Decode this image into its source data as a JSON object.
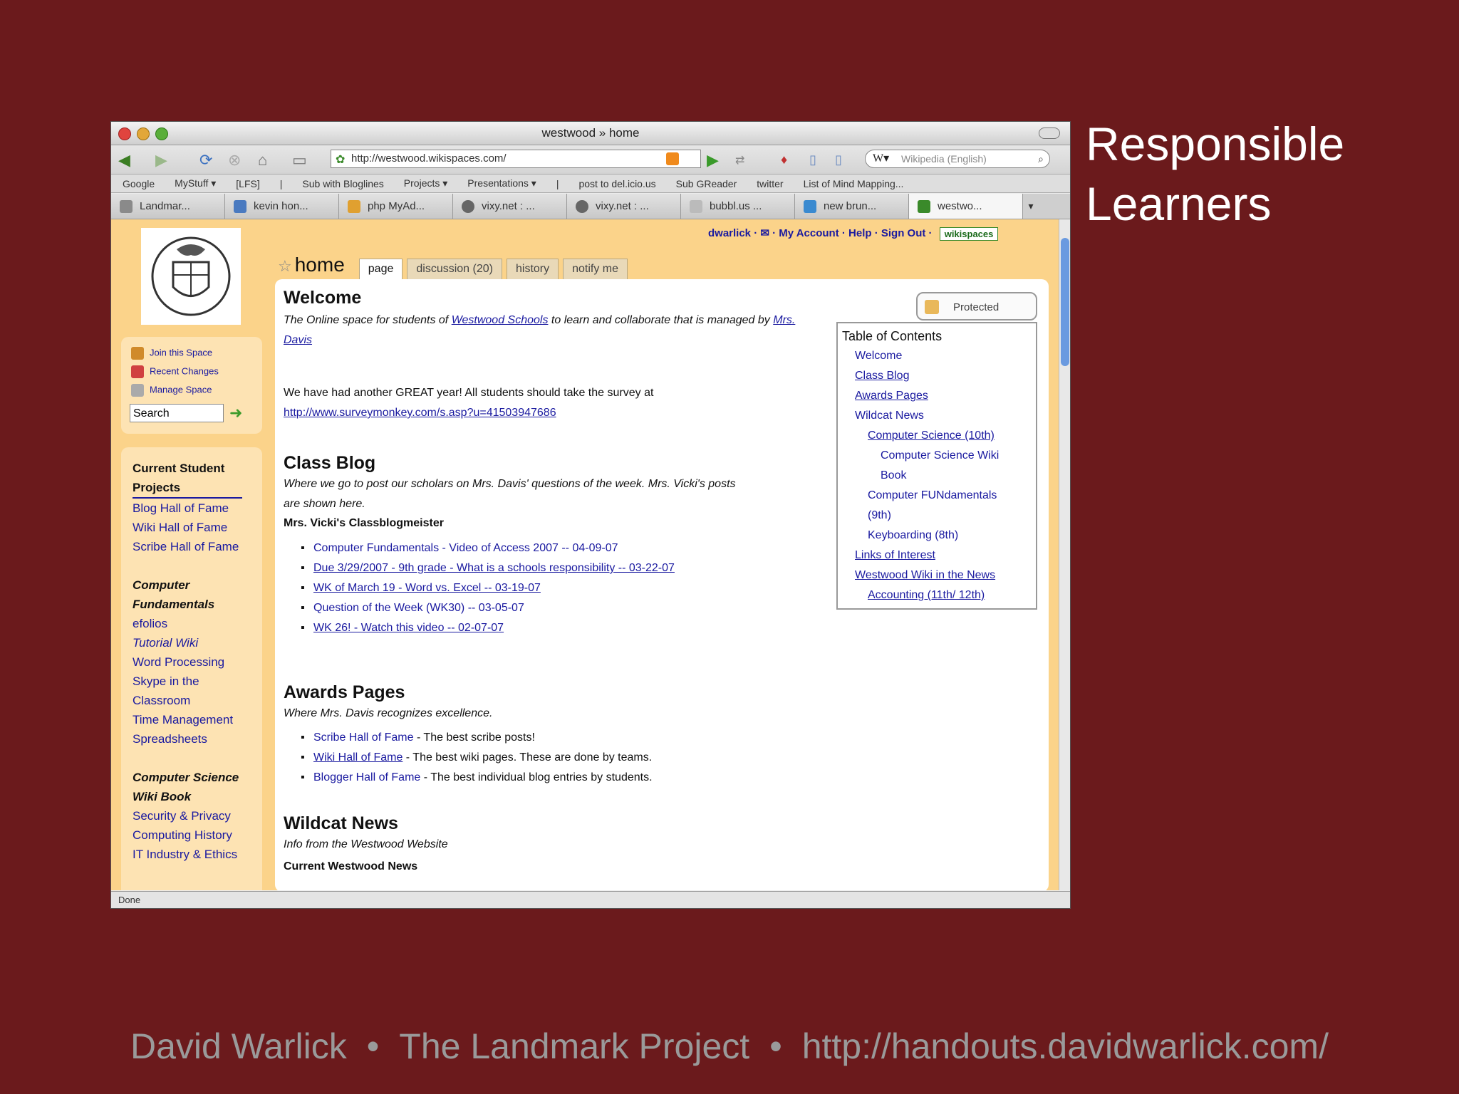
{
  "slide": {
    "title_line1": "Responsible",
    "title_line2": "Learners",
    "footer_author": "David Warlick",
    "footer_sep": "•",
    "footer_project": "The Landmark Project",
    "footer_url": "http://handouts.davidwarlick.com/"
  },
  "browser": {
    "window_title": "westwood » home",
    "url": "http://westwood.wikispaces.com/",
    "search_placeholder": "Wikipedia (English)",
    "status": "Done",
    "bookmarks": [
      "Google",
      "MyStuff ▾",
      "[LFS]",
      "|",
      "Sub with Bloglines",
      "Projects ▾",
      "Presentations ▾",
      "|",
      "post to del.icio.us",
      "Sub GReader",
      "twitter",
      "List of Mind Mapping..."
    ],
    "tabs": [
      "Landmar...",
      "kevin hon...",
      "php MyAd...",
      "vixy.net : ...",
      "vixy.net : ...",
      "bubbl.us ...",
      "new brun...",
      "westwo..."
    ]
  },
  "wiki": {
    "user_links": "dwarlick · ✉ · My Account · Help · Sign Out ·",
    "badge": "wikispaces",
    "home_title": "home",
    "page_tabs": [
      "page",
      "discussion (20)",
      "history",
      "notify me"
    ],
    "side_links": [
      "Join this Space",
      "Recent Changes",
      "Manage Space"
    ],
    "search_value": "Search",
    "projects": {
      "heading1": "Current Student",
      "heading2": "Projects",
      "items1": [
        "Blog Hall of Fame",
        "Wiki Hall of Fame",
        "Scribe Hall of Fame"
      ],
      "cf_heading1": "Computer",
      "cf_heading2": "Fundamentals",
      "cf_items": [
        "efolios",
        "Tutorial Wiki",
        "Word Processing",
        "Skype in the",
        "Classroom",
        "Time Management",
        "Spreadsheets"
      ],
      "cs_heading1": "Computer Science",
      "cs_heading2": "Wiki Book",
      "cs_items": [
        "Security & Privacy",
        "Computing History",
        "IT Industry & Ethics"
      ]
    },
    "protected": "Protected",
    "welcome": {
      "heading": "Welcome",
      "desc_pre": "The Online space for students of ",
      "desc_link": "Westwood Schools",
      "desc_mid": " to learn and collaborate that is managed by ",
      "desc_link2": "Mrs.",
      "desc_link3": "Davis",
      "survey_text": "We have had another GREAT year! All students should take the survey at",
      "survey_url": "http://www.surveymonkey.com/s.asp?u=41503947686"
    },
    "blog": {
      "heading": "Class Blog",
      "desc1": "Where we go to post our scholars on Mrs. Davis' questions of the week. Mrs. Vicki's posts",
      "desc2": "are shown here.",
      "sub": "Mrs. Vicki's Classblogmeister",
      "items": [
        "Computer Fundamentals - Video of Access 2007 -- 04-09-07",
        "Due 3/29/2007 - 9th grade - What is a schools responsibility -- 03-22-07",
        "WK of March 19 - Word vs. Excel -- 03-19-07",
        "Question of the Week (WK30) -- 03-05-07",
        "WK 26! - Watch this video -- 02-07-07"
      ]
    },
    "awards": {
      "heading": "Awards Pages",
      "desc": "Where Mrs. Davis recognizes excellence.",
      "items": [
        {
          "link": "Scribe Hall of Fame",
          "text": " - The best scribe posts!"
        },
        {
          "link": "Wiki Hall of Fame",
          "text": " - The best wiki pages. These are done by teams."
        },
        {
          "link": "Blogger Hall of Fame",
          "text": " - The best individual blog entries by students."
        }
      ]
    },
    "news": {
      "heading": "Wildcat News",
      "desc": "Info from the Westwood Website",
      "sub": "Current Westwood News"
    },
    "toc": {
      "title": "Table of Contents",
      "items": [
        "Welcome",
        "Class Blog",
        "Awards Pages",
        "Wildcat News",
        "Computer Science (10th)",
        "Computer Science Wiki",
        "Book",
        "Computer FUNdamentals",
        "(9th)",
        "Keyboarding (8th)",
        "Links of Interest",
        "Westwood Wiki in the News",
        "Accounting (11th/ 12th)"
      ]
    }
  },
  "colors": {
    "background": "#6b1a1c",
    "wiki_bg": "#fbd38a",
    "link": "#1a1aa0"
  }
}
